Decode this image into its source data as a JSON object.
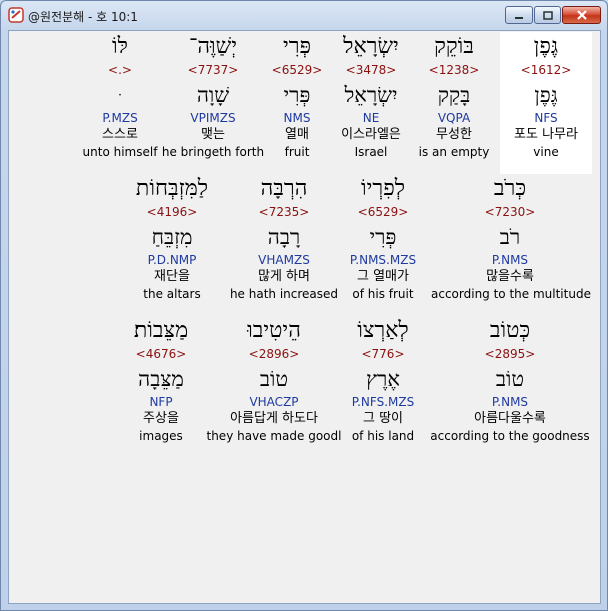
{
  "window": {
    "title": "@원전분해 - 호 10:1"
  },
  "rows": [
    {
      "words": [
        {
          "hebrew": "גֶּפֶן",
          "strong": "<1612>",
          "lemma": "גֶּפֶן",
          "parse": "NFS",
          "korean": "포도 나무라",
          "english": "vine",
          "highlight": true
        },
        {
          "hebrew": "בּוֹקֵק",
          "strong": "<1238>",
          "lemma": "בָּקַק",
          "parse": "VQPA",
          "korean": "무성한",
          "english": "is an empty"
        },
        {
          "hebrew": "יִשְׂרָאֵל",
          "strong": "<3478>",
          "lemma": "יִשְׂרָאֵל",
          "parse": "NE",
          "korean": "이스라엘은",
          "english": "Israel"
        },
        {
          "hebrew": "פְּרִי",
          "strong": "<6529>",
          "lemma": "פְּרִי",
          "parse": "NMS",
          "korean": "열매",
          "english": "fruit"
        },
        {
          "hebrew": "יְשַׁוֶּה־",
          "strong": "<7737>",
          "lemma": "שָׁוָה",
          "parse": "VPIMZS",
          "korean": "맺는",
          "english": "he bringeth forth"
        },
        {
          "hebrew": "לּוֹ",
          "strong": "<.>",
          "lemma": "ּ",
          "parse": "P.MZS",
          "korean": "스스로",
          "english": "unto himself"
        }
      ]
    },
    {
      "words": [
        {
          "hebrew": "כְּרֹב",
          "strong": "<7230>",
          "lemma": "רֹב",
          "parse": "P.NMS",
          "korean": "많을수록",
          "english": "according to the multitude"
        },
        {
          "hebrew": "לְפִרְיוֹ",
          "strong": "<6529>",
          "lemma": "פְּרִי",
          "parse": "P.NMS.MZS",
          "korean": "그 열매가",
          "english": "of his fruit"
        },
        {
          "hebrew": "הִרְבָּה",
          "strong": "<7235>",
          "lemma": "רָבָה",
          "parse": "VHAMZS",
          "korean": "많게 하며",
          "english": "he hath increased"
        },
        {
          "hebrew": "לַמִּזְבְּחוֹת",
          "strong": "<4196>",
          "lemma": "מִזְבֵּחַ",
          "parse": "P.D.NMP",
          "korean": "재단을",
          "english": "the altars"
        }
      ]
    },
    {
      "words": [
        {
          "hebrew": "כְּטוֹב",
          "strong": "<2895>",
          "lemma": "טוֹב",
          "parse": "P.NMS",
          "korean": "아름다울수록",
          "english": "according to the goodness"
        },
        {
          "hebrew": "לְאַרְצוֹ",
          "strong": "<776>",
          "lemma": "אֶרֶץ",
          "parse": "P.NFS.MZS",
          "korean": "그 땅이",
          "english": "of his land"
        },
        {
          "hebrew": "הֵיטִיבוּ",
          "strong": "<2896>",
          "lemma": "טוֹב",
          "parse": "VHACZP",
          "korean": "아름답게 하도다",
          "english": "they have made goodl"
        },
        {
          "hebrew": "מַצֵּבוֹת׃",
          "strong": "<4676>",
          "lemma": "מַצֵּבָה",
          "parse": "NFP",
          "korean": "주상을",
          "english": "images"
        }
      ]
    }
  ]
}
